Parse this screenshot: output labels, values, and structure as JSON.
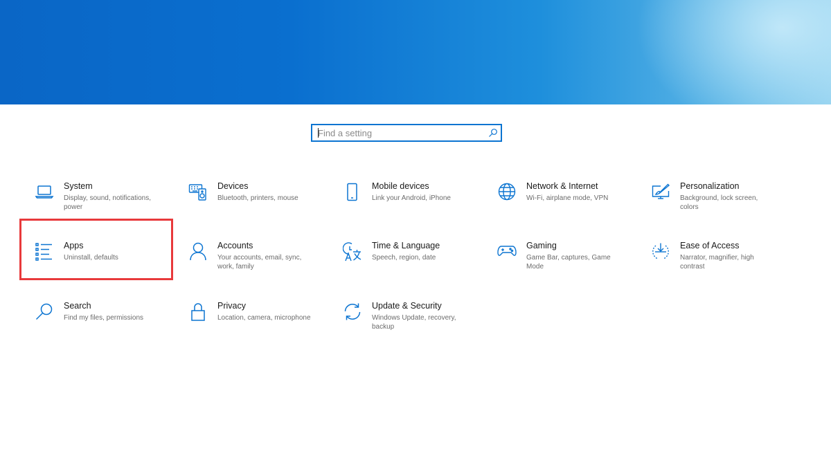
{
  "search": {
    "placeholder": "Find a setting"
  },
  "colors": {
    "accent": "#0b74d1",
    "highlight": "#e8393b"
  },
  "tiles": [
    {
      "title": "System",
      "desc": "Display, sound, notifications, power",
      "icon": "laptop-icon"
    },
    {
      "title": "Devices",
      "desc": "Bluetooth, printers, mouse",
      "icon": "keyboard-speaker-icon"
    },
    {
      "title": "Mobile devices",
      "desc": "Link your Android, iPhone",
      "icon": "phone-icon"
    },
    {
      "title": "Network & Internet",
      "desc": "Wi-Fi, airplane mode, VPN",
      "icon": "globe-icon"
    },
    {
      "title": "Personalization",
      "desc": "Background, lock screen, colors",
      "icon": "paint-monitor-icon"
    },
    {
      "title": "Apps",
      "desc": "Uninstall, defaults",
      "icon": "apps-list-icon"
    },
    {
      "title": "Accounts",
      "desc": "Your accounts, email, sync, work, family",
      "icon": "person-icon"
    },
    {
      "title": "Time & Language",
      "desc": "Speech, region, date",
      "icon": "time-language-icon"
    },
    {
      "title": "Gaming",
      "desc": "Game Bar, captures, Game Mode",
      "icon": "gamepad-icon"
    },
    {
      "title": "Ease of Access",
      "desc": "Narrator, magnifier, high contrast",
      "icon": "ease-of-access-icon"
    },
    {
      "title": "Search",
      "desc": "Find my files, permissions",
      "icon": "search-icon"
    },
    {
      "title": "Privacy",
      "desc": "Location, camera, microphone",
      "icon": "lock-icon"
    },
    {
      "title": "Update & Security",
      "desc": "Windows Update, recovery, backup",
      "icon": "sync-arrows-icon"
    }
  ]
}
